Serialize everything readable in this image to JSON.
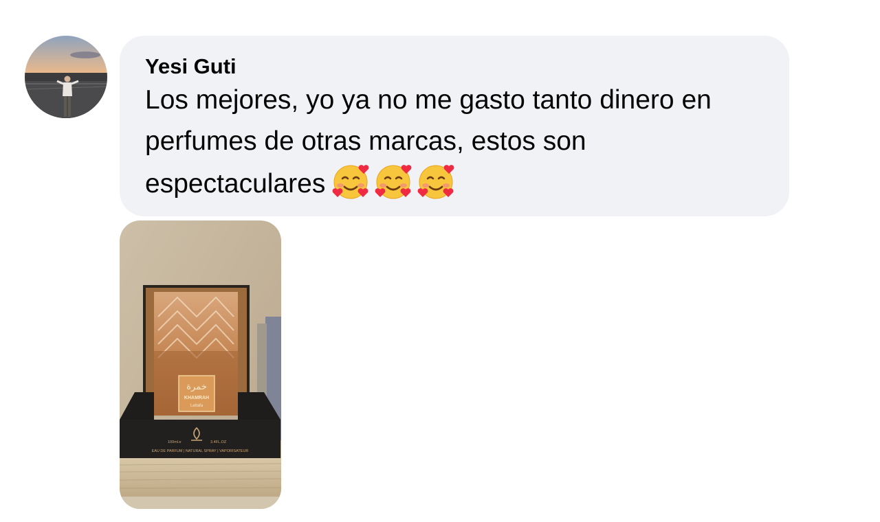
{
  "comment": {
    "author": "Yesi Guti",
    "text": "Los mejores, yo ya no me gasto tanto dinero en perfumes de otras marcas, estos son espectaculares",
    "emojis": [
      "smiling-face-with-hearts",
      "smiling-face-with-hearts",
      "smiling-face-with-hearts"
    ]
  },
  "attachment": {
    "arabic": "خمرة",
    "product_name": "KHAMRAH",
    "brand": "Lattafa",
    "volume": "100ml.e",
    "volume_oz": "3.4FL.OZ",
    "box_caption": "EAU DE PARFUM | NATURAL SPRAY | VAPORISATEUR"
  }
}
